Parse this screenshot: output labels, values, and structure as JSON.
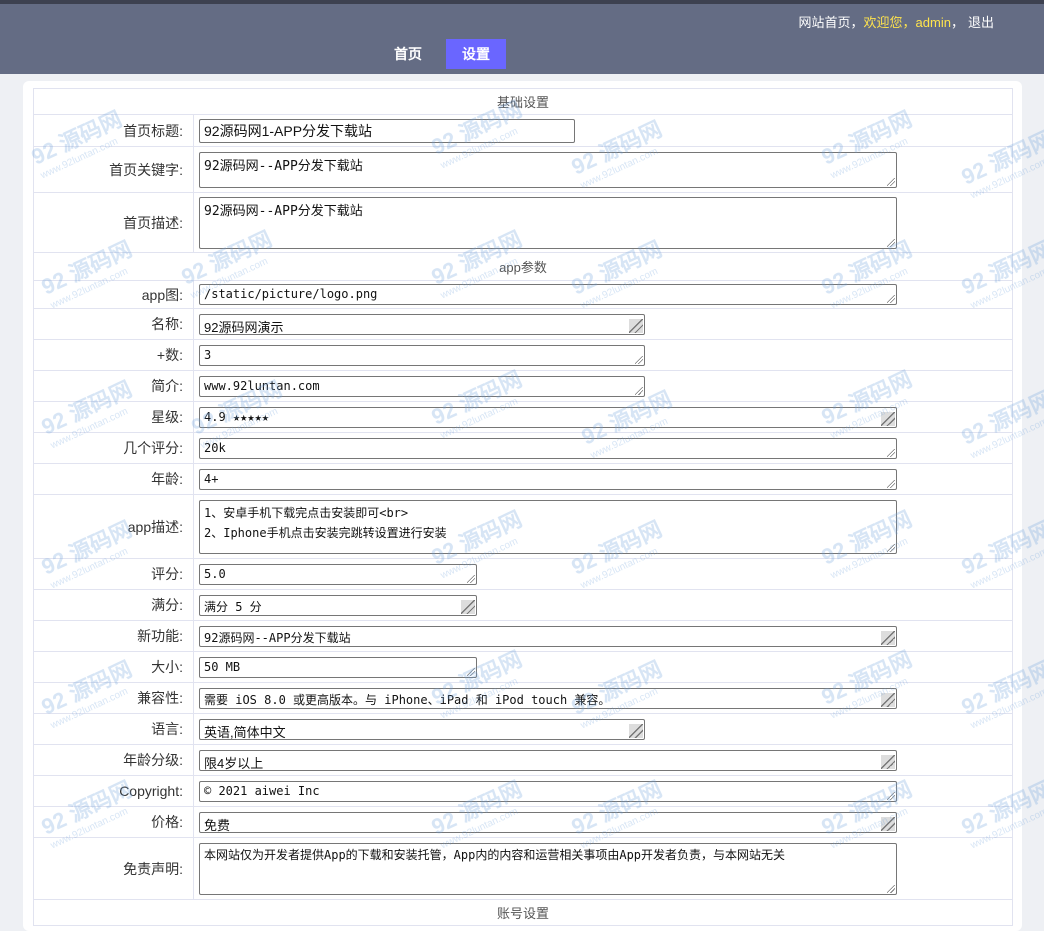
{
  "header": {
    "links": {
      "home": "网站首页",
      "sep1": "，",
      "welcome": "欢迎您，",
      "user": "admin",
      "sep2": "，",
      "logout": "退出"
    },
    "nav": [
      {
        "label": "首页"
      },
      {
        "label": "设置",
        "active": true
      }
    ],
    "accent_color": "#6a66ff",
    "bar_color": "#646c84"
  },
  "sections": {
    "basic": "基础设置",
    "app": "app参数",
    "account": "账号设置"
  },
  "basic": {
    "title": {
      "label": "首页标题:",
      "value": "92源码网1-APP分发下载站"
    },
    "keywords": {
      "label": "首页关键字:",
      "value": "92源码网--APP分发下载站"
    },
    "description": {
      "label": "首页描述:",
      "value": "92源码网--APP分发下载站"
    }
  },
  "app": {
    "image": {
      "label": "app图:",
      "value": "/static/picture/logo.png"
    },
    "name": {
      "label": "名称:",
      "value": "92源码网演示"
    },
    "plus": {
      "label": "+数:",
      "value": "3"
    },
    "intro": {
      "label": "简介:",
      "value": "www.92luntan.com"
    },
    "stars": {
      "label": "星级:",
      "value": "4.9 ★★★★★"
    },
    "ratings_count": {
      "label": "几个评分:",
      "value": "20k"
    },
    "age": {
      "label": "年龄:",
      "value": "4+"
    },
    "app_desc": {
      "label": "app描述:",
      "value": "1、安卓手机下载完点击安装即可<br>\n2、Iphone手机点击安装完跳转设置进行安装"
    },
    "score": {
      "label": "评分:",
      "value": "5.0"
    },
    "full_score": {
      "label": "满分:",
      "value": "满分 5 分"
    },
    "new_feature": {
      "label": "新功能:",
      "value": "92源码网--APP分发下载站"
    },
    "size": {
      "label": "大小:",
      "value": "50 MB"
    },
    "compat": {
      "label": "兼容性:",
      "value": "需要 iOS 8.0 或更高版本。与 iPhone、iPad 和 iPod touch 兼容。"
    },
    "language": {
      "label": "语言:",
      "value": "英语,简体中文"
    },
    "age_rating": {
      "label": "年龄分级:",
      "value": "限4岁以上"
    },
    "copyright": {
      "label": "Copyright:",
      "value": "© 2021 aiwei Inc"
    },
    "price": {
      "label": "价格:",
      "value": "免费"
    },
    "disclaimer": {
      "label": "免责声明:",
      "value": "本网站仅为开发者提供App的下载和安装托管，App内的内容和运营相关事项由App开发者负责，与本网站无关"
    }
  },
  "watermark": {
    "line1": "92 源码网",
    "line2": "www.92luntan.com"
  }
}
